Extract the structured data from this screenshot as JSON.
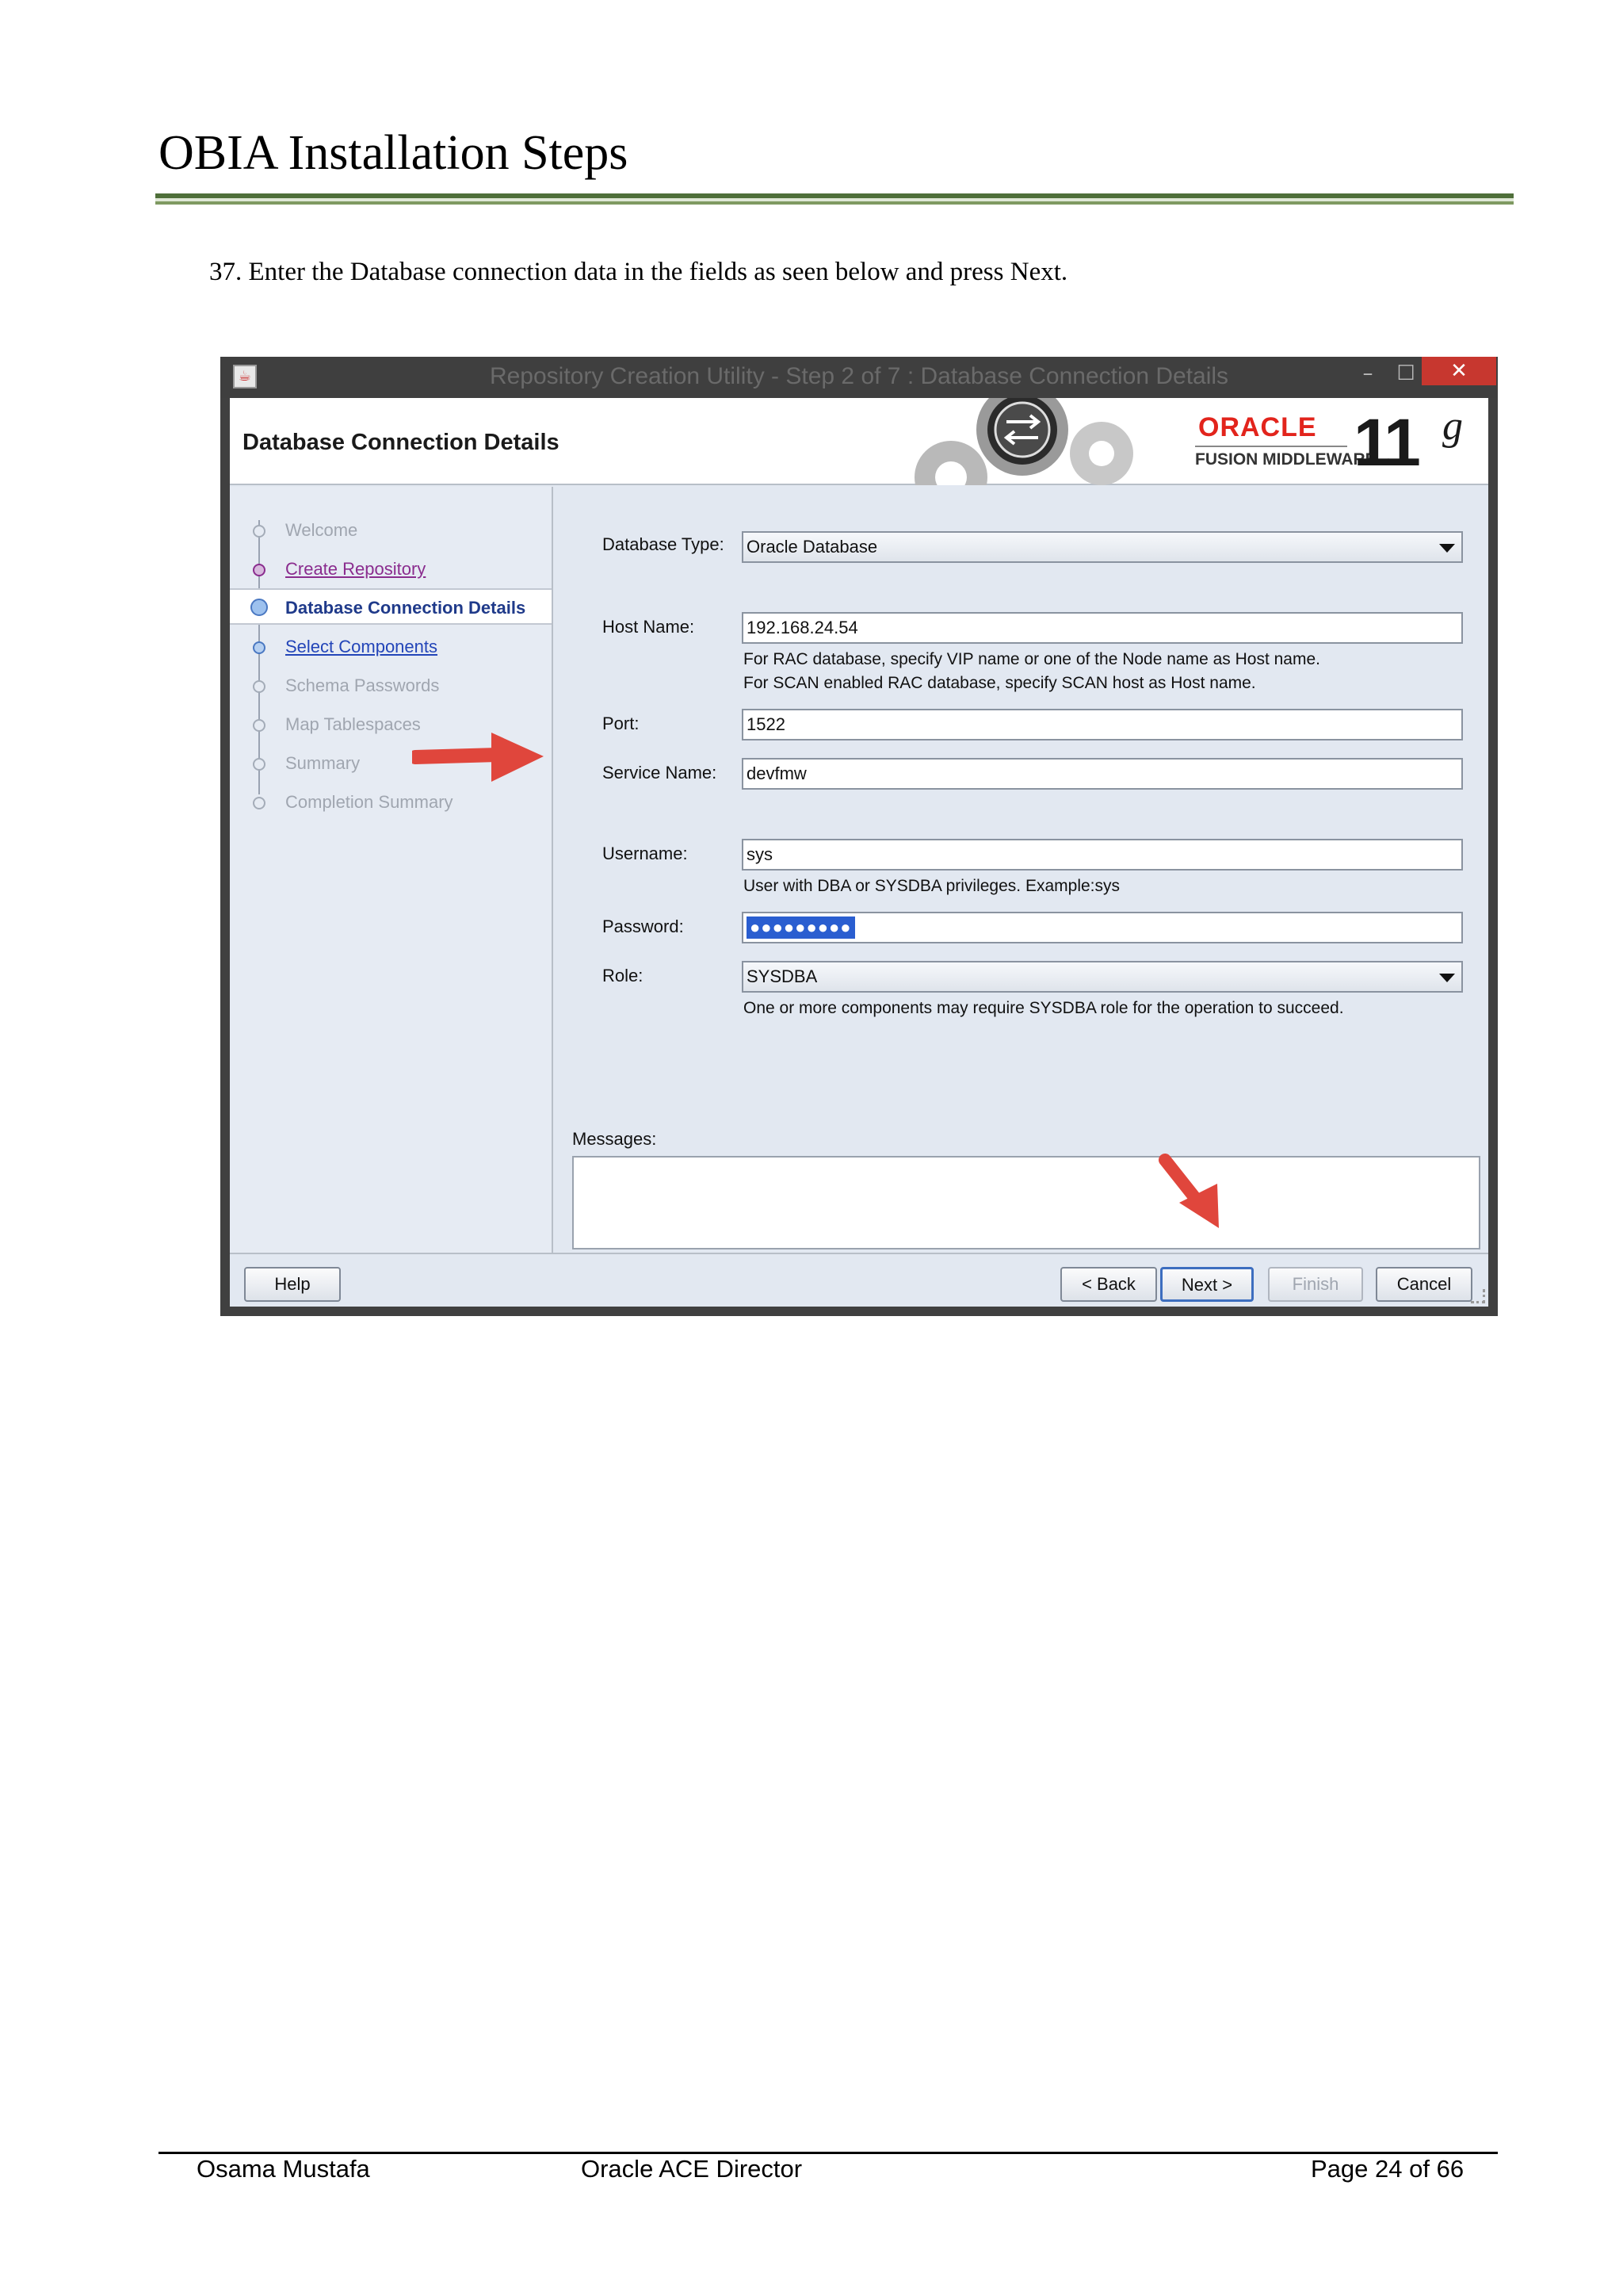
{
  "document": {
    "title": "OBIA Installation Steps",
    "step_text": "37.  Enter the Database connection data in the fields as seen below and press Next."
  },
  "window": {
    "title": "Repository Creation Utility - Step 2 of 7 : Database Connection Details",
    "minimize": "–",
    "maximize": "☐",
    "close": "✕",
    "header_title": "Database Connection Details",
    "brand": {
      "oracle": "ORACLE",
      "fmw": "FUSION MIDDLEWARE",
      "version_number": "11",
      "version_letter": "g"
    }
  },
  "nav": {
    "items": [
      {
        "label": "Welcome",
        "state": "disabled"
      },
      {
        "label": "Create Repository",
        "state": "visited"
      },
      {
        "label": "Database Connection Details",
        "state": "active"
      },
      {
        "label": "Select Components",
        "state": "link"
      },
      {
        "label": "Schema Passwords",
        "state": "disabled"
      },
      {
        "label": "Map Tablespaces",
        "state": "disabled"
      },
      {
        "label": "Summary",
        "state": "disabled"
      },
      {
        "label": "Completion Summary",
        "state": "disabled"
      }
    ]
  },
  "form": {
    "database_type": {
      "label": "Database Type:",
      "value": "Oracle Database"
    },
    "host_name": {
      "label": "Host Name:",
      "value": "192.168.24.54",
      "hint1": "For RAC database, specify VIP name or one of the Node name as Host name.",
      "hint2": "For SCAN enabled RAC database, specify SCAN host as Host name."
    },
    "port": {
      "label": "Port:",
      "value": "1522"
    },
    "service_name": {
      "label": "Service Name:",
      "value": "devfmw"
    },
    "username": {
      "label": "Username:",
      "value": "sys",
      "hint": "User with DBA or SYSDBA privileges. Example:sys"
    },
    "password": {
      "label": "Password:",
      "value": "●●●●●●●●●"
    },
    "role": {
      "label": "Role:",
      "value": "SYSDBA",
      "hint": "One or more components may require SYSDBA role for the operation to succeed."
    },
    "messages_label": "Messages:"
  },
  "buttons": {
    "help": "Help",
    "back": "< Back",
    "next": "Next >",
    "finish": "Finish",
    "cancel": "Cancel"
  },
  "footer": {
    "author": "Osama Mustafa",
    "role": "Oracle ACE Director",
    "page": "Page 24 of 66"
  },
  "colors": {
    "annotation_arrow": "#e0463c",
    "title_rule": "#4f6f3a",
    "close_button": "#c7372f"
  }
}
